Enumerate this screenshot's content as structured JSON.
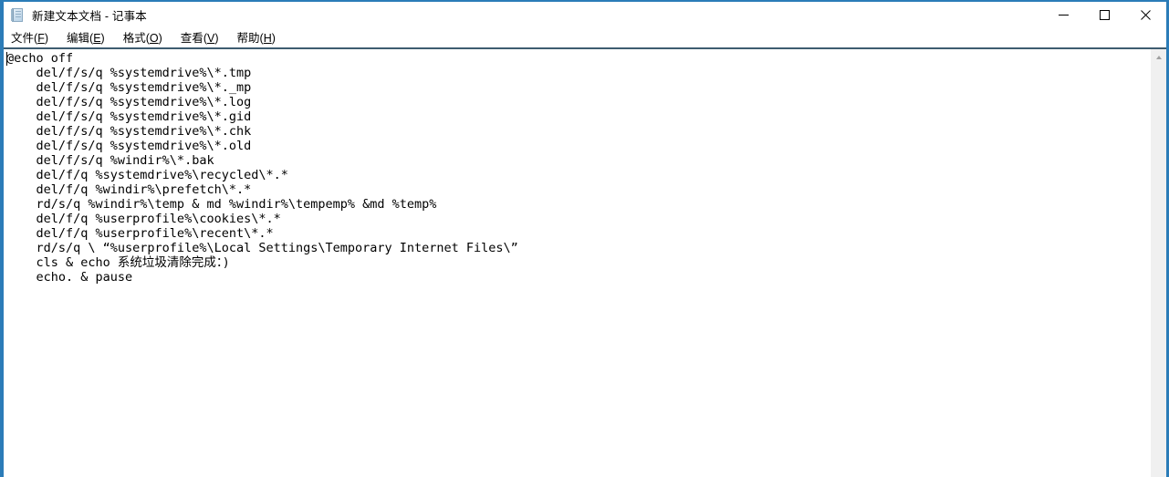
{
  "window": {
    "title": "新建文本文档 - 记事本",
    "icon": "notepad-icon",
    "border_color": "#2b7cb8",
    "menu_separator_color": "#3e5c70"
  },
  "window_controls": {
    "minimize": {
      "icon": "minimize-icon",
      "label": "最小化"
    },
    "maximize": {
      "icon": "maximize-icon",
      "label": "最大化"
    },
    "close": {
      "icon": "close-icon",
      "label": "关闭"
    }
  },
  "menu": {
    "items": [
      {
        "text": "文件",
        "accelerator": "F"
      },
      {
        "text": "编辑",
        "accelerator": "E"
      },
      {
        "text": "格式",
        "accelerator": "O"
      },
      {
        "text": "查看",
        "accelerator": "V"
      },
      {
        "text": "帮助",
        "accelerator": "H"
      }
    ]
  },
  "editor": {
    "lines": [
      "@echo off",
      "    del/f/s/q %systemdrive%\\*.tmp",
      "    del/f/s/q %systemdrive%\\*._mp",
      "    del/f/s/q %systemdrive%\\*.log",
      "    del/f/s/q %systemdrive%\\*.gid",
      "    del/f/s/q %systemdrive%\\*.chk",
      "    del/f/s/q %systemdrive%\\*.old",
      "    del/f/s/q %windir%\\*.bak",
      "    del/f/q %systemdrive%\\recycled\\*.*",
      "    del/f/q %windir%\\prefetch\\*.*",
      "    rd/s/q %windir%\\temp & md %windir%\\tempemp% &md %temp%",
      "    del/f/q %userprofile%\\cookies\\*.*",
      "    del/f/q %userprofile%\\recent\\*.*",
      "    rd/s/q \\ “%userprofile%\\Local Settings\\Temporary Internet Files\\”",
      "    cls & echo 系统垃圾清除完成：)",
      "    echo. & pause"
    ],
    "text": "@echo off\n    del/f/s/q %systemdrive%\\*.tmp\n    del/f/s/q %systemdrive%\\*._mp\n    del/f/s/q %systemdrive%\\*.log\n    del/f/s/q %systemdrive%\\*.gid\n    del/f/s/q %systemdrive%\\*.chk\n    del/f/s/q %systemdrive%\\*.old\n    del/f/s/q %windir%\\*.bak\n    del/f/q %systemdrive%\\recycled\\*.*\n    del/f/q %windir%\\prefetch\\*.*\n    rd/s/q %windir%\\temp & md %windir%\\tempemp% &md %temp%\n    del/f/q %userprofile%\\cookies\\*.*\n    del/f/q %userprofile%\\recent\\*.*\n    rd/s/q \\ “%userprofile%\\Local Settings\\Temporary Internet Files\\”\n    cls & echo 系统垃圾清除完成：)\n    echo. & pause"
  },
  "scrollbar": {
    "up_arrow": "chevron-up-icon",
    "orientation": "vertical"
  }
}
